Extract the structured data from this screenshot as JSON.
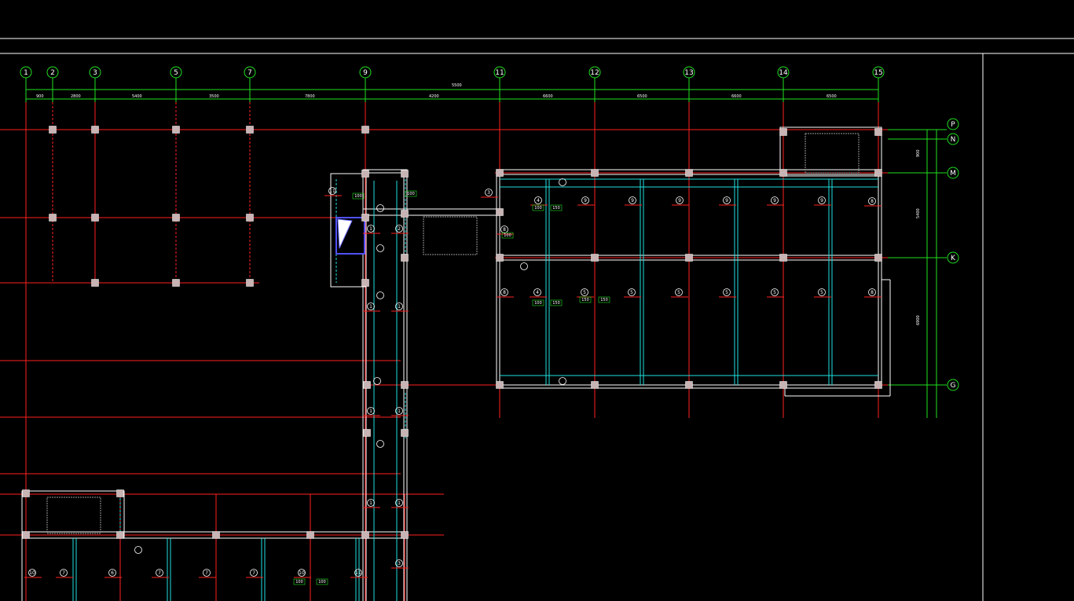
{
  "drawing": {
    "column_axes": [
      "1",
      "2",
      "3",
      "5",
      "7",
      "9",
      "11",
      "12",
      "13",
      "14",
      "15"
    ],
    "row_axes": [
      "P",
      "N",
      "M",
      "K",
      "G"
    ],
    "overall_dimension": "5500",
    "bay_dimensions": [
      "900",
      "2800",
      "5400",
      "3500",
      "7800",
      "4200",
      "6600",
      "6500",
      "6600",
      "6500"
    ],
    "right_dimensions": [
      "700",
      "900",
      "5400",
      "6900"
    ],
    "beam_tags": [
      "1",
      "2",
      "3",
      "4",
      "5",
      "6",
      "7",
      "8",
      "9",
      "10",
      "11",
      "12",
      "13"
    ],
    "beam_section_labels": [
      "100",
      "150",
      "200"
    ]
  },
  "colors": {
    "background": "#000000",
    "axis_line": "#ff2020",
    "dimension_line": "#20e020",
    "beam": "#ffffff",
    "secondary_beam": "#20e0e0",
    "column": "#c8b4b4",
    "stair_hatch": "#9a9a9a"
  },
  "chrome": {
    "top_frame": true,
    "right_border": true
  }
}
